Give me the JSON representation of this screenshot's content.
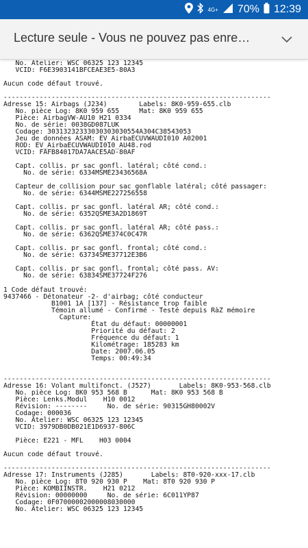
{
  "status_bar": {
    "signal_label": "4G+",
    "battery": "70%",
    "time": "12:39",
    "icons": [
      "location-icon",
      "bluetooth-icon",
      "signal-icon",
      "battery-icon"
    ]
  },
  "banner": {
    "title": "Lecture seule - Vous ne pouvez pas enre…",
    "chevron_icon": "chevron-down-icon"
  },
  "document": {
    "lines": [
      "   No. Atelier: WSC 06325 123 12345",
      "   VCID: F6E3903141BFCEAE3E5-80A3",
      "",
      "Aucun code défaut trouvé.",
      "",
      "-------------------------------------------------------------------",
      "Adresse 15: Airbags (J234)        Labels: 8K0-959-655.clb",
      "   No. pièce Log: 8K0 959 655     Mat: 8K0 959 655",
      "   Pièce: AirbagVW-AU10 H21 0334",
      "   No. de série: 0038GD087LUK",
      "   Codage: 30313232333030303030554A304C38543053",
      "   Jeu de données ASAM: EV_AirbaECUVWAUDI010 A02001",
      "   ROD: EV_AirbaECUVWAUDI010_AU48.rod",
      "   VCID: FAFB84017DA7AACE5AD-80AF",
      "",
      "   Capt. collis. pr sac gonfl. latéral; côté cond.:",
      "     No. de série: 6334MSME23436568A",
      "",
      "   Capteur de collision pour sac gonflable latéral; côté passager:",
      "     No. de série: 6344MSME227256558",
      "",
      "   Capt. collis. pr sac gonfl. latéral AR; côté cond.:",
      "     No. de série: 6352QSME3A2D1869T",
      "",
      "   Capt. collis. pr sac gonfl. latéral AR; côté pass.:",
      "     No. de série: 6362QSME374C0C47R",
      "",
      "   Capt. collis. pr sac gonfl. frontal; côté cond.:",
      "     No. de série: 63734SME37712E3B6",
      "",
      "   Capt. collis. pr sac gonfl. frontal; côté pass. AV:",
      "     No. de série: 63834SME37724F276",
      "",
      "1 Code défaut trouvé:",
      "9437466 - Détonateur -2- d'airbag; côté conducteur",
      "            B1001 1A [137] - Résistance trop faible",
      "            Témoin allumé - Confirmé - Testé depuis RàZ mémoire",
      "              Capture:",
      "                      État du défaut: 00000001",
      "                      Priorité du défaut: 2",
      "                      Fréquence du défaut: 1",
      "                      Kilométrage: 185283 km",
      "                      Date: 2007.06.05",
      "                      Temps: 00:49:34",
      "",
      "",
      "-------------------------------------------------------------------",
      "Adresse 16: Volant multifonct. (J527)       Labels: 8K0-953-568.clb",
      "   No. pièce Log: 8K0 953 568 B      Mat: 8K0 953 568 B",
      "   Pièce: Lenks.Modul    H10 0012",
      "   Révision: --------     No. de série: 90315GH80002V",
      "   Codage: 000036",
      "   No. Atelier: WSC 06325 123 12345",
      "   VCID: 3979DB0DB021E1D6937-806C",
      "",
      "   Pièce: E221 - MFL    H03 0004",
      "",
      "Aucun code défaut trouvé.",
      "",
      "-------------------------------------------------------------------",
      "Adresse 17: Instruments (J285)       Labels: 8T0-920-xxx-17.clb",
      "   No. pièce Log: 8T0 920 930 P    Mat: 8T0 920 930 P",
      "   Pièce: KOMBIINSTR.    H21 0212",
      "   Révision: 00000000     No. de série: 6C011YP87",
      "   Codage: 0F07000002000008030000",
      "   No. Atelier: WSC 06325 123 12345"
    ]
  }
}
